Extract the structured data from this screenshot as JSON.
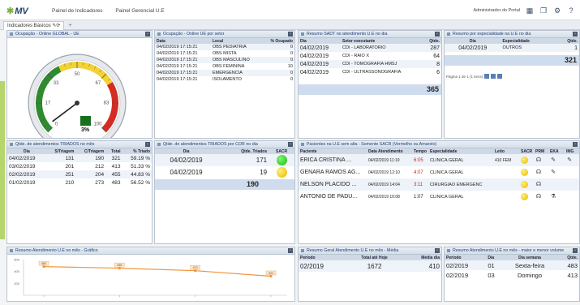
{
  "header": {
    "logo_text": "MV",
    "nav": [
      "Painel de Indicadores",
      "Painel Gerencial U.E"
    ],
    "user_label": "Administrador do Portal"
  },
  "tabs": {
    "active_label": "Indicadores Básicos",
    "add_symbol": "+"
  },
  "gauge": {
    "title": "Ocupação - Online GLOBAL - UE",
    "value_label": "3%",
    "value_percent": 3,
    "ticks": [
      "0",
      "17",
      "33",
      "50",
      "67",
      "83",
      "100"
    ],
    "colors": {
      "green": "#2e8b2e",
      "yellow": "#f2d234",
      "red": "#d62b22"
    }
  },
  "ocupacao_setor": {
    "title": "Ocupação - Online UE por setor",
    "headers": [
      "Data",
      "Local",
      "% Ocupado"
    ],
    "rows": [
      [
        "04/02/2019 17:15:21",
        "OBS PEDIATRIA",
        "0"
      ],
      [
        "04/02/2019 17:15:21",
        "OBS MISTA",
        "0"
      ],
      [
        "04/02/2019 17:15:21",
        "OBS MASCULINO",
        "0"
      ],
      [
        "04/02/2019 17:15:21",
        "OBS FEMININA",
        "10"
      ],
      [
        "04/02/2019 17:15:21",
        "EMERGENCIA",
        "0"
      ],
      [
        "04/02/2019 17:15:21",
        "ISOLAMENTO",
        "0"
      ]
    ]
  },
  "sadt": {
    "title": "Resumo SADT no atendimento U.E no dia",
    "headers": [
      "Dia",
      "Setor executante",
      "Qtde."
    ],
    "rows": [
      [
        "04/02/2019",
        "CDI - LABORATORIO",
        "287"
      ],
      [
        "04/02/2019",
        "CDI - RAIO X",
        "64"
      ],
      [
        "04/02/2019",
        "CDI - TOMOGRAFIA HMSJ",
        "8"
      ],
      [
        "04/02/2019",
        "CDI - ULTRASSONOGRAFIA",
        "6"
      ]
    ],
    "total": "365"
  },
  "especialidade": {
    "title": "Resumo por especialidade na U.E no dia",
    "headers": [
      "Dia",
      "Especialidade",
      "Qtde."
    ],
    "rows": [
      [
        "04/02/2019",
        "OUTROS",
        "1"
      ]
    ],
    "total": "321",
    "pager": "Página 1 de 1 (1 itens)"
  },
  "triados": {
    "title": "Qtde. de atendimentos TRIADOS no mês",
    "headers": [
      "Dia",
      "S/Triagem",
      "C/Triagem",
      "Total",
      "% Triado"
    ],
    "rows": [
      [
        "04/02/2019",
        "131",
        "190",
        "321",
        "59.19 %"
      ],
      [
        "03/02/2019",
        "201",
        "212",
        "413",
        "51.33 %"
      ],
      [
        "02/02/2019",
        "251",
        "204",
        "455",
        "44.83 %"
      ],
      [
        "01/02/2019",
        "210",
        "273",
        "483",
        "56.52 %"
      ]
    ]
  },
  "cor": {
    "title": "Qtde. de atendimentos TRIADOS por COR no dia",
    "headers": [
      "Dia",
      "Qtde. Triados",
      "SACR"
    ],
    "rows": [
      {
        "dia": "04/02/2019",
        "qtde": "171",
        "sacr": "green"
      },
      {
        "dia": "04/02/2019",
        "qtde": "19",
        "sacr": "yellow"
      }
    ],
    "total": "190"
  },
  "pacientes": {
    "title": "Pacientes na U.E sem alta - Somente SACR (Vermelho ou Amarelo)",
    "headers": [
      "Paciente",
      "Data Atendimento",
      "Tempo",
      "Especialidade",
      "Leito",
      "SACR",
      "PRM",
      "EKA",
      "IMG"
    ],
    "rows": [
      [
        "ERICA CRISTINA ...",
        "04/02/2019 11:10",
        "6:05",
        "CLINICA GERAL",
        "410 FEM"
      ],
      [
        "GENARA RAMOS AG...",
        "04/02/2019 12:10",
        "4:07",
        "CLINICA GERAL",
        ""
      ],
      [
        "NELSON PLACIDO ...",
        "04/02/2019 14:04",
        "3:11",
        "CIRURGIAO EMERGENC",
        ""
      ],
      [
        "ANTONIO DE PADU...",
        "04/02/2019 16:08",
        "1:07",
        "CLINICA GERAL",
        ""
      ]
    ],
    "tempo_red": [
      true,
      true,
      true,
      false
    ]
  },
  "grafico": {
    "title": "Resumo Atendimento U.E no mês - Gráfico",
    "y_ticks": [
      "600",
      "400",
      "200"
    ]
  },
  "chart_data": {
    "type": "line",
    "x": [
      "01/02/2019",
      "02/02/2019",
      "03/02/2019",
      "04/02/2019"
    ],
    "series": [
      {
        "values": [
          483,
          455,
          413,
          321
        ]
      }
    ],
    "ylim": [
      0,
      600
    ]
  },
  "geral": {
    "title": "Resumo Geral Atendimento U.E no mês - Média",
    "headers": [
      "Período",
      "Total até Hoje",
      "Média dia"
    ],
    "rows": [
      [
        "02/2019",
        "1672",
        "410"
      ]
    ]
  },
  "semana": {
    "title": "Resumo Atendimento U.E no mês - maior e menor volume",
    "headers": [
      "Período",
      "Dia",
      "Dia semana",
      "Qtde."
    ],
    "rows": [
      [
        "02/2019",
        "01",
        "Sexta-feira",
        "483"
      ],
      [
        "02/2019",
        "03",
        "Domingo",
        "413"
      ]
    ]
  }
}
